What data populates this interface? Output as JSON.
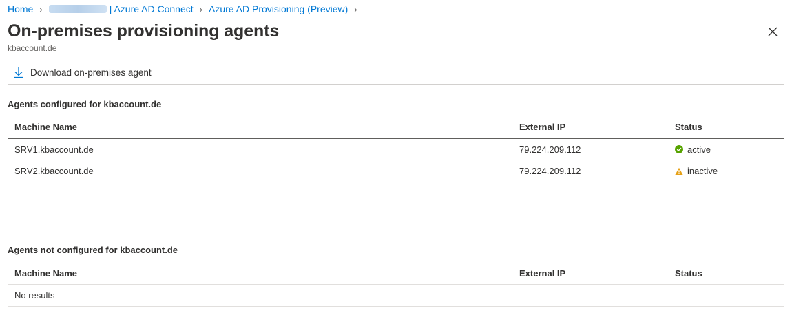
{
  "breadcrumb": {
    "home": "Home",
    "tenant_suffix": "| Azure AD Connect",
    "provisioning": "Azure AD Provisioning (Preview)"
  },
  "page": {
    "title": "On-premises provisioning agents",
    "subtitle": "kbaccount.de"
  },
  "toolbar": {
    "download_label": "Download on-premises agent"
  },
  "configured": {
    "title": "Agents configured for kbaccount.de",
    "columns": [
      "Machine Name",
      "External IP",
      "Status"
    ],
    "rows": [
      {
        "machine": "SRV1.kbaccount.de",
        "ip": "79.224.209.112",
        "status": "active",
        "status_icon": "check-circle-icon",
        "status_color": "#57a300"
      },
      {
        "machine": "SRV2.kbaccount.de",
        "ip": "79.224.209.112",
        "status": "inactive",
        "status_icon": "warning-icon",
        "status_color": "#e6a117"
      }
    ]
  },
  "not_configured": {
    "title": "Agents not configured for kbaccount.de",
    "columns": [
      "Machine Name",
      "External IP",
      "Status"
    ],
    "empty_text": "No results"
  },
  "colors": {
    "link": "#0078d4",
    "text": "#323130",
    "divider": "#e1dfdd"
  }
}
